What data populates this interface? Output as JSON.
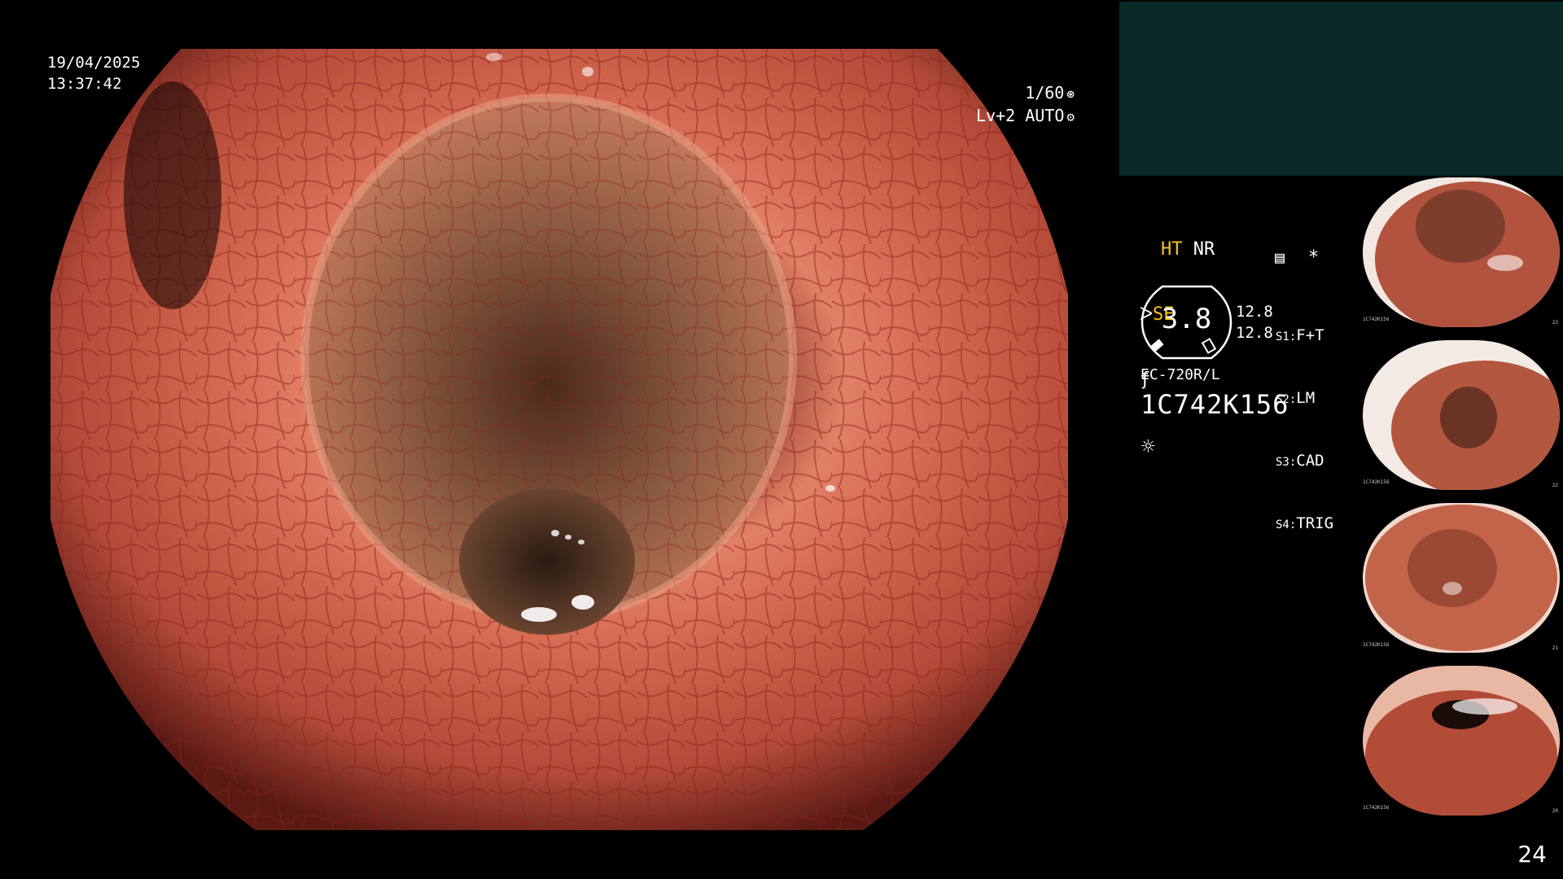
{
  "overlay": {
    "date": "19/04/2025",
    "time": "13:37:42",
    "shutter": "1/60",
    "level": "Lv+2 AUTO"
  },
  "settings": {
    "ht": "HT",
    "nr": "NR",
    "se": "SE",
    "gauge_value": "3.8",
    "gauge_num_1": "12.8",
    "gauge_num_2": "12.8",
    "scope_buttons": [
      {
        "slot": "S1:",
        "value": "F+T"
      },
      {
        "slot": "S2:",
        "value": "LM"
      },
      {
        "slot": "S3:",
        "value": "CAD"
      },
      {
        "slot": "S4:",
        "value": "TRIG"
      }
    ],
    "model": "EC-720R/L",
    "serial": "1C742K156",
    "star": "*"
  },
  "thumbnails": [
    {
      "caption": "1C742K156",
      "num": "23"
    },
    {
      "caption": "1C742K156",
      "num": "22"
    },
    {
      "caption": "1C742K156",
      "num": "21"
    },
    {
      "caption": "1C742K156",
      "num": "20"
    }
  ],
  "page_number": "24",
  "colors": {
    "osd_yellow": "#f6c21a",
    "panel_teal": "#0a2a28",
    "mucosa": "#c45a42"
  },
  "icons": {
    "shutter": "aperture-icon",
    "level": "gear-icon",
    "light": "light-source-icon",
    "filter": "filter-icon"
  }
}
